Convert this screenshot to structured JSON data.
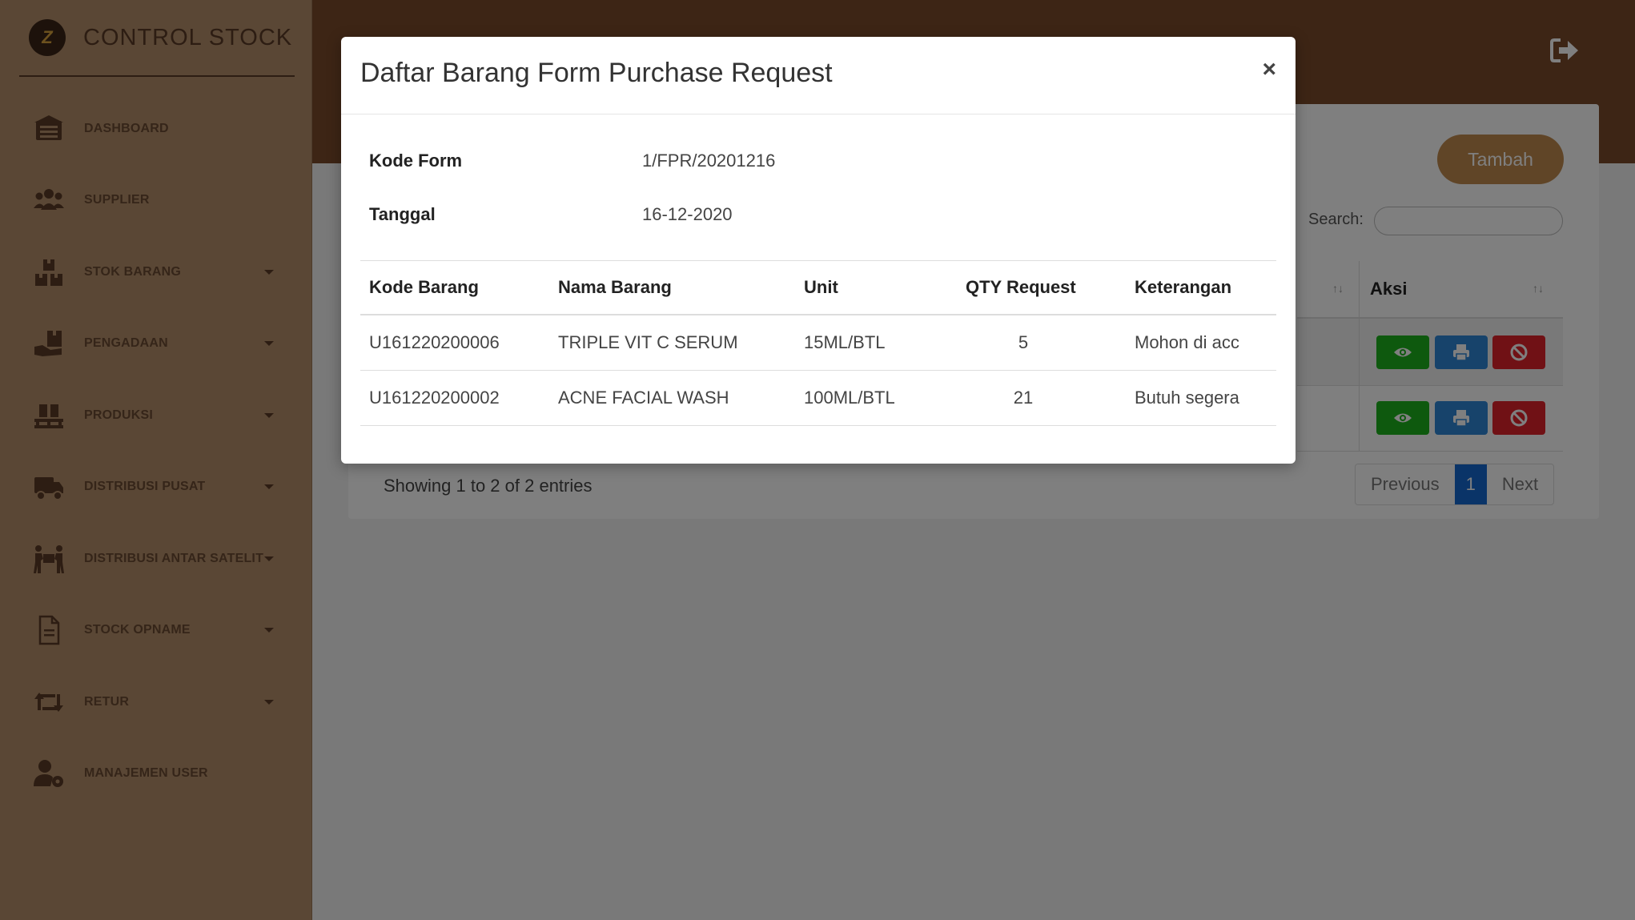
{
  "app": {
    "title": "CONTROL STOCK",
    "logo_glyph": "Z"
  },
  "sidebar": {
    "items": [
      {
        "label": "DASHBOARD",
        "icon": "dashboard-icon",
        "has_caret": false
      },
      {
        "label": "SUPPLIER",
        "icon": "users-icon",
        "has_caret": false
      },
      {
        "label": "STOK BARANG",
        "icon": "boxes-icon",
        "has_caret": true
      },
      {
        "label": "PENGADAAN",
        "icon": "hand-box-icon",
        "has_caret": true
      },
      {
        "label": "PRODUKSI",
        "icon": "pallet-icon",
        "has_caret": true
      },
      {
        "label": "DISTRIBUSI PUSAT",
        "icon": "truck-icon",
        "has_caret": true
      },
      {
        "label": "DISTRIBUSI ANTAR SATELIT",
        "icon": "people-carry-icon",
        "has_caret": true
      },
      {
        "label": "STOCK OPNAME",
        "icon": "document-icon",
        "has_caret": true
      },
      {
        "label": "RETUR",
        "icon": "retweet-icon",
        "has_caret": true
      },
      {
        "label": "MANAJEMEN USER",
        "icon": "user-cog-icon",
        "has_caret": false
      }
    ]
  },
  "page": {
    "add_button": "Tambah",
    "search_label": "Search:",
    "search_value": "",
    "table_header_aksi": "Aksi",
    "sort_glyph": "↑↓",
    "showing_text": "Showing 1 to 2 of 2 entries",
    "pagination": {
      "previous": "Previous",
      "current": "1",
      "next": "Next"
    }
  },
  "modal": {
    "title": "Daftar Barang Form Purchase Request",
    "close_glyph": "×",
    "fields": [
      {
        "label": "Kode Form",
        "value": "1/FPR/20201216"
      },
      {
        "label": "Tanggal",
        "value": "16-12-2020"
      }
    ],
    "table": {
      "headers": [
        "Kode Barang",
        "Nama Barang",
        "Unit",
        "QTY Request",
        "Keterangan"
      ],
      "rows": [
        [
          "U161220200006",
          "TRIPLE VIT C SERUM",
          "15ML/BTL",
          "5",
          "Mohon di acc"
        ],
        [
          "U161220200002",
          "ACNE FACIAL WASH",
          "100ML/BTL",
          "21",
          "Butuh segera"
        ]
      ]
    }
  },
  "colors": {
    "sidebar": "#b48f6a",
    "topbar": "#7b4b2b",
    "accent_button": "#c08a4e",
    "view_button": "#1db31d",
    "print_button": "#2f86d6",
    "delete_button": "#e0232b",
    "page_active": "#1468d1"
  }
}
